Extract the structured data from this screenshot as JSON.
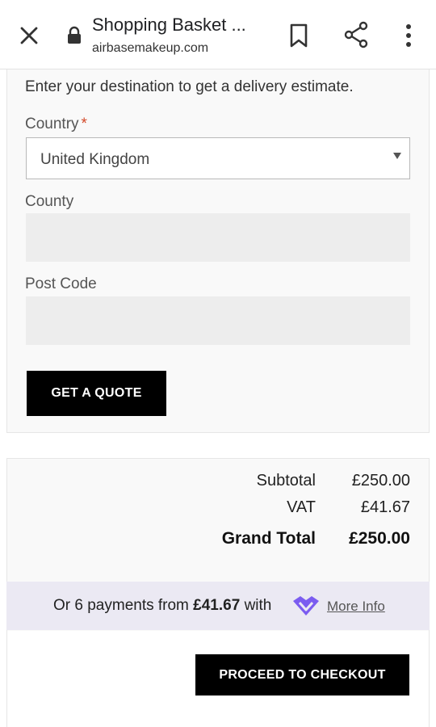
{
  "browser": {
    "page_title": "Shopping Basket ...",
    "url": "airbasemakeup.com",
    "icons": {
      "close": "close-icon",
      "lock": "lock-icon",
      "bookmark": "bookmark-icon",
      "share": "share-icon",
      "more": "more-vert-icon"
    }
  },
  "estimate": {
    "intro": "Enter your destination to get a delivery estimate.",
    "country_label": "Country",
    "required_mark": "*",
    "country_value": "United Kingdom",
    "county_label": "County",
    "county_value": "",
    "postcode_label": "Post Code",
    "postcode_value": "",
    "quote_button": "GET A QUOTE"
  },
  "totals": {
    "subtotal_label": "Subtotal",
    "subtotal_value": "£250.00",
    "vat_label": "VAT",
    "vat_value": "£41.67",
    "grand_label": "Grand Total",
    "grand_value": "£250.00"
  },
  "payments": {
    "prefix": "Or 6 payments from ",
    "amount": "£41.67",
    "suffix": " with",
    "more_info": "More Info",
    "logo": "laybuy-heart-icon"
  },
  "checkout": {
    "button": "PROCEED TO CHECKOUT"
  },
  "colors": {
    "button_bg": "#000000",
    "required": "#d44a2a",
    "payment_band": "#ebe9f3",
    "payment_logo": "#7b5cf0"
  }
}
